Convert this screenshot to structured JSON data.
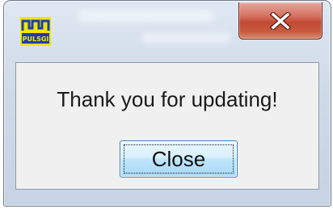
{
  "dialog": {
    "app_icon": "pulsgi-logo-icon",
    "app_icon_text": "PULSGI",
    "close_icon": "close-icon",
    "message": "Thank you for updating!",
    "button_label": "Close"
  },
  "colors": {
    "icon_yellow": "#f2e600",
    "icon_blue": "#1d3fae",
    "close_red": "#c9513b"
  }
}
